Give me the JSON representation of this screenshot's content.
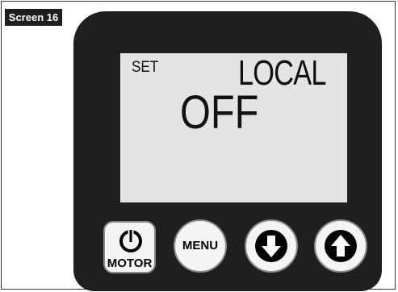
{
  "screen_tag": "Screen 16",
  "display": {
    "set_label": "SET",
    "mode_label": "LOCAL",
    "value": "OFF"
  },
  "buttons": {
    "motor": {
      "label": "MOTOR",
      "icon": "power-icon"
    },
    "menu": {
      "label": "MENU"
    },
    "down": {
      "icon": "arrow-down-icon"
    },
    "up": {
      "icon": "arrow-up-icon"
    }
  },
  "colors": {
    "device_body": "#1f1f1f",
    "lcd_background": "#e4e4e4",
    "button_face": "#f4f4f4"
  }
}
